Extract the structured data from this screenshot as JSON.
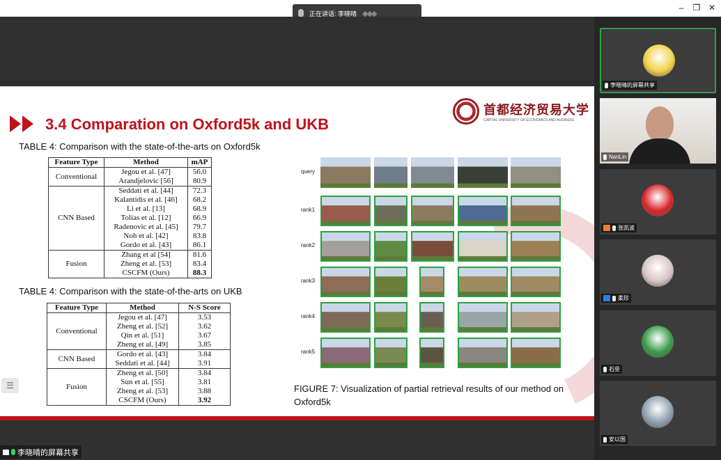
{
  "window": {
    "speaking_label": "正在讲话: 李晓晴",
    "controls": {
      "minimize": "–",
      "restore": "❐",
      "close": "✕"
    }
  },
  "slide": {
    "title": "3.4 Comparation on Oxford5k and UKB",
    "logo_cn": "首都经济贸易大学",
    "logo_en": "CAPITAL UNIVERSITY OF ECONOMICS AND BUSINESS",
    "table1": {
      "caption": "TABLE 4: Comparison with the state-of-the-arts on Oxford5k",
      "headers": [
        "Feature Type",
        "Method",
        "mAP"
      ],
      "groups": [
        {
          "type": "Conventional",
          "rows": [
            [
              "Jegou et al. [47]",
              "56.0"
            ],
            [
              "Arandjelovic [56]",
              "80.9"
            ]
          ]
        },
        {
          "type": "CNN Based",
          "rows": [
            [
              "Seddati et al. [44]",
              "72.3"
            ],
            [
              "Kalantidis et al. [46]",
              "68.2"
            ],
            [
              "Li et al. [13]",
              "68.9"
            ],
            [
              "Tolias et al. [12]",
              "66.9"
            ],
            [
              "Radenovic et al. [45]",
              "79.7"
            ],
            [
              "Noh et al. [42]",
              "83.8"
            ],
            [
              "Gordo et al. [43]",
              "86.1"
            ]
          ]
        },
        {
          "type": "Fusion",
          "rows": [
            [
              "Zhang et al [54]",
              "81.6"
            ],
            [
              "Zheng et al. [53]",
              "83.4"
            ],
            [
              "CSCFM (Ours)",
              "88.3"
            ]
          ]
        }
      ]
    },
    "table2": {
      "caption": "TABLE 4: Comparison with the state-of-the-arts on UKB",
      "headers": [
        "Feature Type",
        "Method",
        "N-S Score"
      ],
      "groups": [
        {
          "type": "Conventional",
          "rows": [
            [
              "Jegou et al. [47]",
              "3.53"
            ],
            [
              "Zheng et al. [52]",
              "3.62"
            ],
            [
              "Qin et al. [51]",
              "3.67"
            ],
            [
              "Zheng et al. [49]",
              "3.85"
            ]
          ]
        },
        {
          "type": "CNN Based",
          "rows": [
            [
              "Gordo et al. [43]",
              "3.84"
            ],
            [
              "Seddati et al. [44]",
              "3.91"
            ]
          ]
        },
        {
          "type": "Fusion",
          "rows": [
            [
              "Zheng et al. [50]",
              "3.84"
            ],
            [
              "Sun et al. [55]",
              "3.81"
            ],
            [
              "Zheng et al. [53]",
              "3.88"
            ],
            [
              "CSCFM (Ours)",
              "3.92"
            ]
          ]
        }
      ]
    },
    "retrieval": {
      "row_labels": [
        "query",
        "rank1",
        "rank2",
        "rank3",
        "rank4",
        "rank5"
      ],
      "colors": [
        [
          "#8a7a62",
          "#6f7d8a",
          "#7f8a93",
          "#3a3f35",
          "#8f8f82"
        ],
        [
          "#9c5a4e",
          "#6d6e59",
          "#8b7a5e",
          "#4d6b96",
          "#8e7453"
        ],
        [
          "#a2a09b",
          "#5f8a43",
          "#7a4c3d",
          "#d9d4c6",
          "#9b7f55"
        ],
        [
          "#8c6d5a",
          "#6b7f3a",
          "#a58a6a",
          "#9c8c60",
          "#a08b64"
        ],
        [
          "#7d6a59",
          "#7a8a4a",
          "#6a5e55",
          "#9aa5a8",
          "#b0a08a"
        ],
        [
          "#8b6a78",
          "#7b8a52",
          "#5d5440",
          "#8a8680",
          "#8a6c4a"
        ]
      ],
      "caption": "FIGURE 7:  Visualization of partial retrieval results of our method on Oxford5k"
    }
  },
  "share_label": "李晓晴的屏幕共享",
  "participants": [
    {
      "name": "李晓晴的屏幕共享",
      "kind": "avatar",
      "color": "#f3d24a"
    },
    {
      "name": "NanLin",
      "kind": "video"
    },
    {
      "name": "张凯波",
      "kind": "avatar",
      "color": "#d7262b"
    },
    {
      "name": "柔珍",
      "kind": "avatar",
      "color": "#d9c6c2"
    },
    {
      "name": "石垒",
      "kind": "avatar",
      "color": "#3c9b4a"
    },
    {
      "name": "安以国",
      "kind": "avatar",
      "color": "#8fa0b0"
    }
  ]
}
